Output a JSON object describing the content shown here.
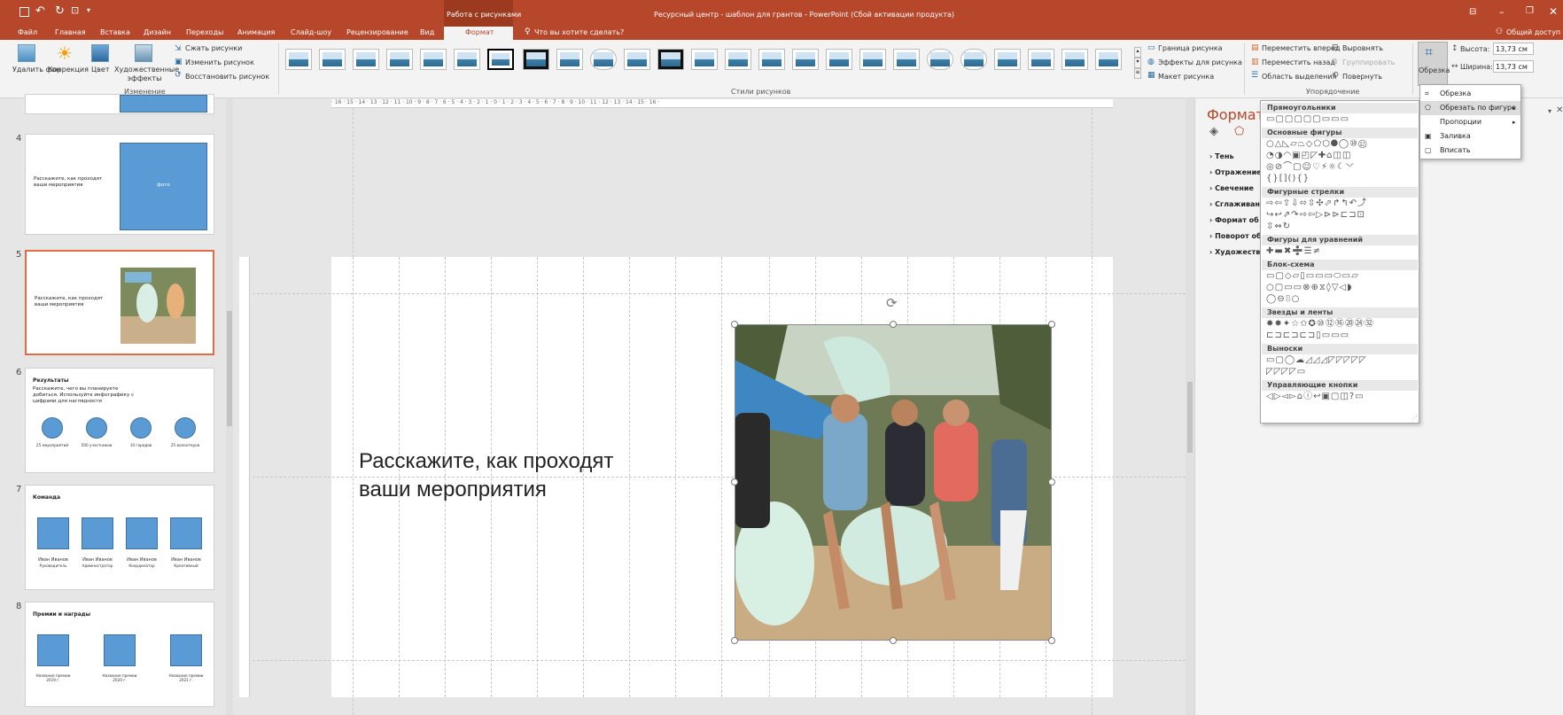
{
  "titlebar": {
    "qat_icons": [
      "save-icon",
      "undo-icon",
      "redo-icon",
      "presentation-icon",
      "customize-icon"
    ],
    "context_tab": "Работа с рисунками",
    "title": "Ресурсный центр - шаблон для грантов - PowerPoint (Сбой активации продукта)",
    "share": "Общий доступ"
  },
  "tabs": [
    "Файл",
    "Главная",
    "Вставка",
    "Дизайн",
    "Переходы",
    "Анимация",
    "Слайд-шоу",
    "Рецензирование",
    "Вид",
    "Формат"
  ],
  "active_tab": "Формат",
  "tell_me": "Что вы хотите сделать?",
  "ribbon": {
    "adjust": {
      "remove_bg": "Удалить фон",
      "corrections": "Коррекция",
      "color": "Цвет",
      "artistic": "Художественные эффекты",
      "compress": "Сжать рисунки",
      "change": "Изменить рисунок",
      "reset": "Восстановить рисунок",
      "label": "Изменение"
    },
    "styles_label": "Стили рисунков",
    "picture_options": [
      "Граница рисунка",
      "Эффекты для рисунка",
      "Макет рисунка"
    ],
    "arrange": {
      "items": [
        "Переместить вперед",
        "Переместить назад",
        "Область выделения"
      ],
      "items2": [
        "Выровнять",
        "Группировать",
        "Повернуть"
      ],
      "label": "Упорядочение"
    },
    "crop": "Обрезка",
    "height_label": "Высота:",
    "height_value": "13,73 см",
    "width_label": "Ширина:",
    "width_value": "13,73 см"
  },
  "slides": [
    {
      "num": "4",
      "text": "Расскажите, как проходят ваши мероприятия",
      "box": "фото"
    },
    {
      "num": "5",
      "text": "Расскажите, как проходят ваши мероприятия"
    },
    {
      "num": "6",
      "title": "Результаты",
      "text": "Расскажите, чего вы планируете добиться. Используйте инфографику с цифрами для наглядности",
      "items": [
        "25 мероприятий",
        "500 участников",
        "10 городов",
        "25 волонтеров"
      ]
    },
    {
      "num": "7",
      "title": "Команда",
      "items": [
        "Иван Иванов",
        "Иван Иванов",
        "Иван Иванов",
        "Иван Иванов"
      ],
      "roles": [
        "Руководитель",
        "Администратор",
        "Координатор",
        "Креативный"
      ]
    },
    {
      "num": "8",
      "title": "Премии и награды",
      "items": [
        "Название премии 2019 г.",
        "Название премии 2020 г.",
        "Название премии 2021 г."
      ]
    }
  ],
  "ruler_h": "· 16 · 15 · 14 · 13 · 12 · 11 · 10 · 9 · 8 · 7 · 6 · 5 · 4 · 3 · 2 · 1 · 0 · 1 · 2 · 3 · 4 · 5 · 6 · 7 · 8 · 9 · 10 · 11 · 12 · 13 · 14 · 15 · 16 ·",
  "slide_text_line1": "Расскажите, как проходят",
  "slide_text_line2": "ваши мероприятия",
  "format_pane": {
    "title": "Формат р",
    "sections": [
      "Тень",
      "Отражение",
      "Свечение",
      "Сглаживан",
      "Формат об",
      "Поворот об",
      "Художеств"
    ]
  },
  "shape_menu": {
    "categories": [
      "Прямоугольники",
      "Основные фигуры",
      "Фигурные стрелки",
      "Фигуры для уравнений",
      "Блок-схема",
      "Звезды и ленты",
      "Выноски",
      "Управляющие кнопки"
    ]
  },
  "crop_menu": {
    "items": [
      "Обрезка",
      "Обрезать по фигуре",
      "Пропорции",
      "Заливка",
      "Вписать"
    ]
  }
}
